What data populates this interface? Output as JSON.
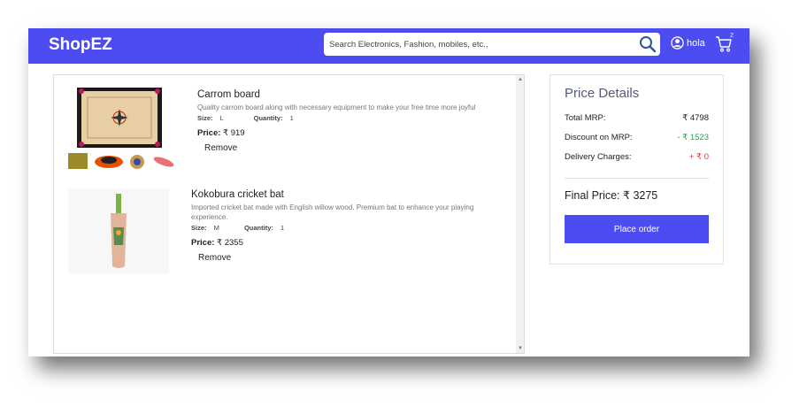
{
  "navbar": {
    "brand": "ShopEZ",
    "search_placeholder": "Search Electronics, Fashion, mobiles, etc.,",
    "user_name": "hola",
    "cart_count": "2"
  },
  "cart_items": [
    {
      "title": "Carrom board",
      "description": "Quality carrom board along with necessary equipment to make your free time more joyful",
      "size_label": "Size:",
      "size": "L",
      "quantity_label": "Quantity:",
      "quantity": "1",
      "price_label": "Price:",
      "price": "₹ 919",
      "remove_label": "Remove"
    },
    {
      "title": "Kokobura cricket bat",
      "description_line1": "Imported cricket bat made with English willow wood. Premium bat to enhance your playing",
      "description_line2": "experience.",
      "size_label": "Size:",
      "size": "M",
      "quantity_label": "Quantity:",
      "quantity": "1",
      "price_label": "Price:",
      "price": "₹ 2355",
      "remove_label": "Remove"
    }
  ],
  "price_details": {
    "title": "Price Details",
    "total_mrp_label": "Total MRP:",
    "total_mrp": "₹ 4798",
    "discount_label": "Discount on MRP:",
    "discount": "- ₹ 1523",
    "delivery_label": "Delivery Charges:",
    "delivery": "+ ₹ 0",
    "final_label": "Final Price:",
    "final_price": "₹ 3275",
    "place_order": "Place order"
  },
  "colors": {
    "accent": "#4c4cf0",
    "discount": "#2e9e4f",
    "delivery": "#e53935"
  }
}
